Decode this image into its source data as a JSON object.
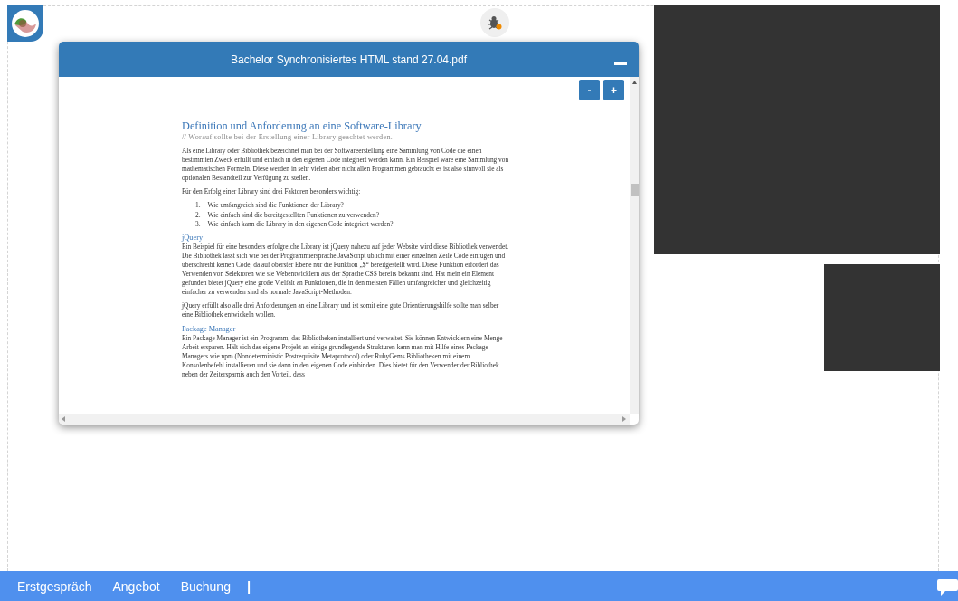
{
  "dialog": {
    "title": "Bachelor Synchronisiertes HTML stand 27.04.pdf",
    "zoom_buttons": [
      "-",
      "+"
    ]
  },
  "document": {
    "blocks": [
      {
        "kind": "title",
        "text": "Definition und Anforderung an eine Software-Library"
      },
      {
        "kind": "subtitle",
        "text": "// Worauf sollte bei der Erstellung einer Library geachtet werden."
      },
      {
        "kind": "paragraph",
        "text": "Als eine Library oder Bibliothek bezeichnet man bei der Softwareerstellung eine Sammlung von Code die einen bestimmten Zweck erfüllt und einfach in den eigenen Code integriert werden kann. Ein Beispiel wäre eine Sammlung von mathematischen Formeln. Diese werden in sehr vielen aber nicht allen Programmen gebraucht es ist also sinnvoll sie als optionalen Bestandteil zur Verfügung zu stellen."
      },
      {
        "kind": "paragraph",
        "text": "Für den Erfolg einer Library sind drei Faktoren besonders wichtig:"
      },
      {
        "kind": "list",
        "items": [
          {
            "number": "1.",
            "text": "Wie umfangreich sind die Funktionen der Library?"
          },
          {
            "number": "2.",
            "text": "Wie einfach sind die bereitgestellten Funktionen zu verwenden?"
          },
          {
            "number": "3.",
            "text": "Wie einfach kann die Library in den eigenen Code integriert werden?"
          }
        ]
      },
      {
        "kind": "section",
        "text": "jQuery"
      },
      {
        "kind": "body",
        "text": "Ein Beispiel für eine besonders erfolgreiche Library ist jQuery nahezu auf jeder Website wird diese Bibliothek verwendet. Die Bibliothek lässt sich wie bei der Programmiersprache JavaScript üblich mit einer einzelnen Zeile Code einfügen und überschreibt keinen Code, da auf oberster Ebene nur die Funktion „$“ bereitgestellt wird. Diese Funktion erfordert das Verwenden von Selektoren wie sie Webentwicklern aus der Sprache CSS bereits bekannt sind. Hat mein ein Element gefunden bietet jQuery eine große Vielfalt an Funktionen, die in den meisten Fällen umfangreicher und gleichzeitig einfacher zu verwenden sind als normale JavaScript-Methoden."
      },
      {
        "kind": "paragraph",
        "text": "jQuery erfüllt also alle drei Anforderungen an eine Library und ist somit eine gute Orientierungshilfe sollte man selber eine Bibliothek entwickeln wollen."
      },
      {
        "kind": "section",
        "text": "Package Manager"
      },
      {
        "kind": "body",
        "text": "Ein Package Manager ist ein Programm, das Bibliotheken installiert und verwaltet. Sie können Entwicklern eine Menge Arbeit ersparen. Hält sich das eigene Projekt an einige grundlegende Strukturen kann man mit Hilfe eines Package Managers wie npm (Nondeterministic Postrequisite Metaprotocol) oder RubyGems Bibliotheken mit einem Konsolenbefehl installieren und sie dann in den eigenen Code einbinden. Dies bietet für den Verwender der Bibliothek neben der Zeitersparnis auch den Vorteil, dass"
      }
    ]
  },
  "nav": {
    "items": [
      "Erstgespräch",
      "Angebot",
      "Buchung"
    ],
    "cursor": "|"
  }
}
